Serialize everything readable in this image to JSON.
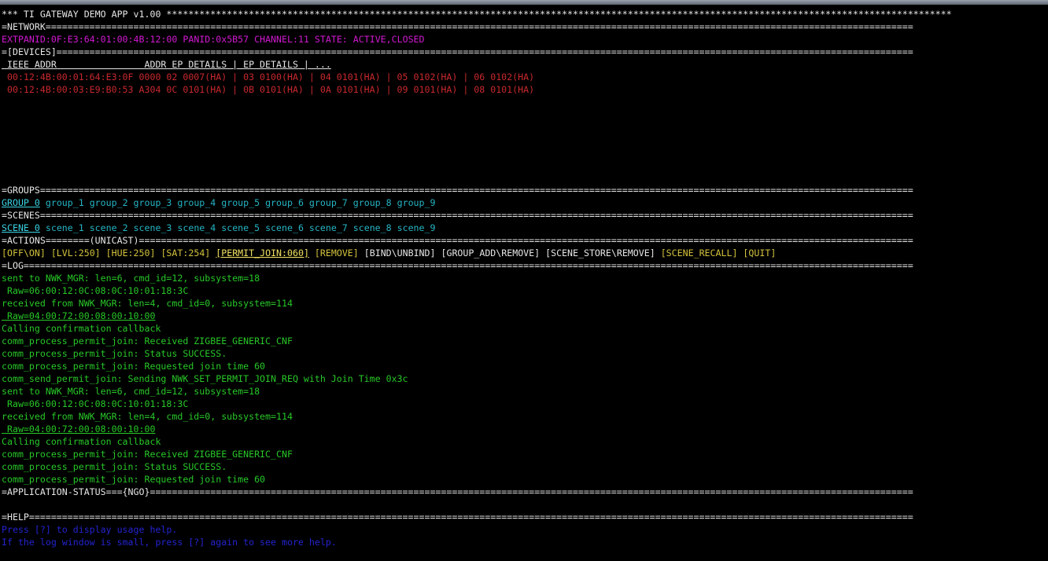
{
  "title_line": "*** TI GATEWAY DEMO APP v1.00 ***********************************************************************************************************************************************",
  "network": {
    "header": "=NETWORK==============================================================================================================================================================",
    "extpanid": "EXTPANID:0F:E3:64:01:00:4B:12:00",
    "panid": "PANID:0x5B57",
    "channel": "CHANNEL:11",
    "state_label": "STATE:",
    "state_value": "ACTIVE,CLOSED"
  },
  "devices": {
    "header": "=[DEVICES]============================================================================================================================================================",
    "columns": " IEEE ADDR                ADDR EP DETAILS | EP DETAILS | ...",
    "rows": [
      " 00:12:4B:00:01:64:E3:0F 0000 02 0007(HA) | 03 0100(HA) | 04 0101(HA) | 05 0102(HA) | 06 0102(HA)",
      " 00:12:4B:00:03:E9:B0:53 A304 0C 0101(HA) | 0B 0101(HA) | 0A 0101(HA) | 09 0101(HA) | 08 0101(HA)"
    ]
  },
  "groups": {
    "header": "=GROUPS===============================================================================================================================================================",
    "selected": "GROUP 0",
    "items": [
      " group_1",
      " group_2",
      " group_3",
      " group_4",
      " group_5",
      " group_6",
      " group_7",
      " group_8",
      " group_9"
    ]
  },
  "scenes": {
    "header": "=SCENES===============================================================================================================================================================",
    "selected": "SCENE 0",
    "items": [
      " scene_1",
      " scene_2",
      " scene_3",
      " scene_4",
      " scene_5",
      " scene_6",
      " scene_7",
      " scene_8",
      " scene_9"
    ]
  },
  "actions": {
    "header": "=ACTIONS========(UNICAST)=============================================================================================================================================",
    "items": [
      {
        "label": "[OFF\\ON]",
        "highlight": false
      },
      {
        "label": "[LVL:250]",
        "highlight": false
      },
      {
        "label": "[HUE:250]",
        "highlight": false
      },
      {
        "label": "[SAT:254]",
        "highlight": false
      },
      {
        "label": "[PERMIT_JOIN:060]",
        "highlight": true
      },
      {
        "label": "[REMOVE]",
        "highlight": false
      },
      {
        "label": "[BIND\\UNBIND]",
        "highlight": false,
        "white": true
      },
      {
        "label": "[GROUP_ADD\\REMOVE]",
        "highlight": false,
        "white": true
      },
      {
        "label": "[SCENE_STORE\\REMOVE]",
        "highlight": false,
        "white": true
      },
      {
        "label": "[SCENE_RECALL]",
        "highlight": false
      },
      {
        "label": "[QUIT]",
        "highlight": false
      }
    ]
  },
  "log": {
    "header": "=LOG==================================================================================================================================================================",
    "lines": [
      {
        "text": "sent to NWK_MGR: len=6, cmd_id=12, subsystem=18",
        "ul": false
      },
      {
        "text": " Raw=06:00:12:0C:08:0C:10:01:18:3C",
        "ul": false
      },
      {
        "text": "received from NWK_MGR: len=4, cmd_id=0, subsystem=114",
        "ul": false
      },
      {
        "text": " Raw=04:00:72:00:08:00:10:00",
        "ul": true
      },
      {
        "text": "Calling confirmation callback",
        "ul": false
      },
      {
        "text": "comm_process_permit_join: Received ZIGBEE_GENERIC_CNF",
        "ul": false
      },
      {
        "text": "comm_process_permit_join: Status SUCCESS.",
        "ul": false
      },
      {
        "text": "comm_process_permit_join: Requested join time 60",
        "ul": false
      },
      {
        "text": "comm_send_permit_join: Sending NWK_SET_PERMIT_JOIN_REQ with Join Time 0x3c",
        "ul": false
      },
      {
        "text": "sent to NWK_MGR: len=6, cmd_id=12, subsystem=18",
        "ul": false
      },
      {
        "text": " Raw=06:00:12:0C:08:0C:10:01:18:3C",
        "ul": false
      },
      {
        "text": "received from NWK_MGR: len=4, cmd_id=0, subsystem=114",
        "ul": false
      },
      {
        "text": " Raw=04:00:72:00:08:00:10:00",
        "ul": true
      },
      {
        "text": "Calling confirmation callback",
        "ul": false
      },
      {
        "text": "comm_process_permit_join: Received ZIGBEE_GENERIC_CNF",
        "ul": false
      },
      {
        "text": "comm_process_permit_join: Status SUCCESS.",
        "ul": false
      },
      {
        "text": "comm_process_permit_join: Requested join time 60",
        "ul": false
      }
    ]
  },
  "app_status": {
    "header": "=APPLICATION-STATUS==={NGO}===========================================================================================================================================",
    "text": ""
  },
  "help": {
    "header": "=HELP=================================================================================================================================================================",
    "lines": [
      "Press [?] to display usage help.",
      "If the log window is small, press [?] again to see more help."
    ]
  },
  "colors": {
    "background": "#000000",
    "network_info": "#d21ad2",
    "device_rows": "#c8282d",
    "groups_scenes": "#25b5c4",
    "actions": "#d2c23c",
    "log": "#28c828",
    "help": "#2323d2"
  }
}
